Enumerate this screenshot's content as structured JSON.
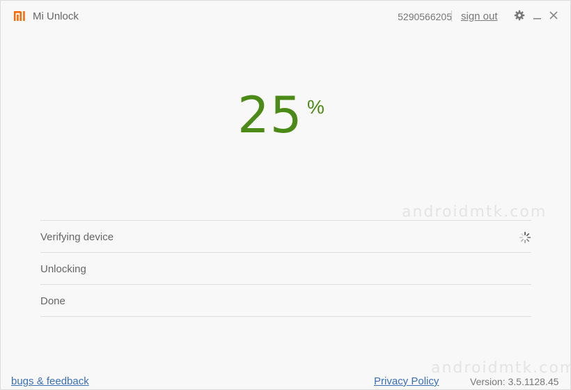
{
  "titlebar": {
    "app_title": "Mi Unlock",
    "account_id": "5290566205",
    "sign_out": "sign out",
    "logo_icon": "mi-logo-icon",
    "settings_icon": "gear-icon",
    "minimize_icon": "minimize-icon",
    "close_icon": "close-icon"
  },
  "progress": {
    "value": "25",
    "unit": "%",
    "fraction": 0.25
  },
  "steps": [
    {
      "label": "Verifying device",
      "status": "in-progress",
      "icon": "spinner-icon"
    },
    {
      "label": "Unlocking",
      "status": "pending"
    },
    {
      "label": "Done",
      "status": "pending"
    }
  ],
  "watermarks": [
    "androidmtk.com",
    "androidmtk.com"
  ],
  "footer": {
    "bugs_feedback": "bugs & feedback",
    "privacy_policy": "Privacy Policy",
    "version": "Version: 3.5.1128.45"
  },
  "colors": {
    "brand": "#ff6700",
    "progress": "#4b8a17",
    "link": "#3a6fb5",
    "background": "#f8f8f8"
  }
}
